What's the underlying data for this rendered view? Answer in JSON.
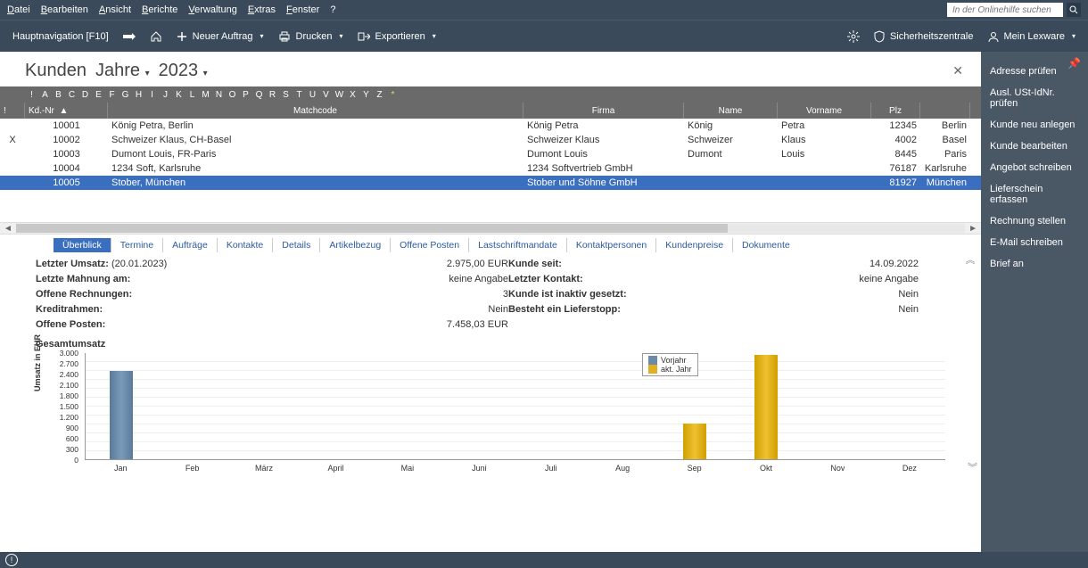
{
  "menu": {
    "items": [
      "Datei",
      "Bearbeiten",
      "Ansicht",
      "Berichte",
      "Verwaltung",
      "Extras",
      "Fenster",
      "?"
    ]
  },
  "search": {
    "placeholder": "In der Onlinehilfe suchen"
  },
  "toolbar": {
    "nav_label": "Hauptnavigation [F10]",
    "neuer_auftrag": "Neuer Auftrag",
    "drucken": "Drucken",
    "exportieren": "Exportieren",
    "sicherheit": "Sicherheitszentrale",
    "mein_lexware": "Mein Lexware"
  },
  "header": {
    "kunden": "Kunden",
    "jahre": "Jahre",
    "year": "2023"
  },
  "filter_letters": [
    "!",
    "A",
    "B",
    "C",
    "D",
    "E",
    "F",
    "G",
    "H",
    "I",
    "J",
    "K",
    "L",
    "M",
    "N",
    "O",
    "P",
    "Q",
    "R",
    "S",
    "T",
    "U",
    "V",
    "W",
    "X",
    "Y",
    "Z",
    "*"
  ],
  "columns": {
    "mark": "!",
    "kdnr": "Kd.-Nr",
    "matchcode": "Matchcode",
    "firma": "Firma",
    "name": "Name",
    "vorname": "Vorname",
    "plz": "Plz",
    "ort": ""
  },
  "rows": [
    {
      "mark": "",
      "kdnr": "10001",
      "match": "König Petra, Berlin",
      "firma": "König Petra",
      "name": "König",
      "vor": "Petra",
      "plz": "12345",
      "ort": "Berlin",
      "sel": false
    },
    {
      "mark": "X",
      "kdnr": "10002",
      "match": "Schweizer Klaus, CH-Basel",
      "firma": "Schweizer Klaus",
      "name": "Schweizer",
      "vor": "Klaus",
      "plz": "4002",
      "ort": "Basel",
      "sel": false
    },
    {
      "mark": "",
      "kdnr": "10003",
      "match": "Dumont Louis, FR-Paris",
      "firma": "Dumont Louis",
      "name": "Dumont",
      "vor": "Louis",
      "plz": "8445",
      "ort": "Paris",
      "sel": false
    },
    {
      "mark": "",
      "kdnr": "10004",
      "match": "1234 Soft, Karlsruhe",
      "firma": "1234 Softvertrieb GmbH",
      "name": "",
      "vor": "",
      "plz": "76187",
      "ort": "Karlsruhe",
      "sel": false
    },
    {
      "mark": "",
      "kdnr": "10005",
      "match": "Stober, München",
      "firma": "Stober und Söhne GmbH",
      "name": "",
      "vor": "",
      "plz": "81927",
      "ort": "München",
      "sel": true
    }
  ],
  "tabs": [
    "Überblick",
    "Termine",
    "Aufträge",
    "Kontakte",
    "Details",
    "Artikelbezug",
    "Offene Posten",
    "Lastschriftmandate",
    "Kontaktpersonen",
    "Kundenpreise",
    "Dokumente"
  ],
  "overview": {
    "letzter_umsatz_lbl": "Letzter Umsatz:",
    "letzter_umsatz_date": "(20.01.2023)",
    "letzter_umsatz_val": "2.975,00 EUR",
    "letzte_mahnung_lbl": "Letzte Mahnung am:",
    "letzte_mahnung_val": "keine Angabe",
    "offene_rech_lbl": "Offene Rechnungen:",
    "offene_rech_val": "3",
    "kreditrahmen_lbl": "Kreditrahmen:",
    "kreditrahmen_val": "Nein",
    "offene_posten_lbl": "Offene Posten:",
    "offene_posten_val": "7.458,03 EUR",
    "kunde_seit_lbl": "Kunde seit:",
    "kunde_seit_val": "14.09.2022",
    "letzter_kontakt_lbl": "Letzter Kontakt:",
    "letzter_kontakt_val": "keine Angabe",
    "inaktiv_lbl": "Kunde ist inaktiv gesetzt:",
    "inaktiv_val": "Nein",
    "lieferstopp_lbl": "Besteht ein Lieferstopp:",
    "lieferstopp_val": "Nein"
  },
  "chart_data": {
    "type": "bar",
    "title": "Gesamtumsatz",
    "ylabel": "Umsatz in EUR",
    "ylim": [
      0,
      3000
    ],
    "yticks": [
      0,
      300,
      600,
      900,
      1200,
      1500,
      1800,
      2100,
      2400,
      2700,
      3000
    ],
    "categories": [
      "Jan",
      "Feb",
      "März",
      "April",
      "Mai",
      "Juni",
      "Juli",
      "Aug",
      "Sep",
      "Okt",
      "Nov",
      "Dez"
    ],
    "series": [
      {
        "name": "Vorjahr",
        "values": [
          2500,
          0,
          0,
          0,
          0,
          0,
          0,
          0,
          0,
          0,
          0,
          0
        ]
      },
      {
        "name": "akt. Jahr",
        "values": [
          0,
          0,
          0,
          0,
          0,
          0,
          0,
          0,
          1000,
          2950,
          0,
          0
        ]
      }
    ],
    "legend": [
      "Vorjahr",
      "akt. Jahr"
    ]
  },
  "sidebar_actions": [
    "Adresse prüfen",
    "Ausl. USt-IdNr. prüfen",
    "Kunde neu anlegen",
    "Kunde bearbeiten",
    "Angebot schreiben",
    "Lieferschein erfassen",
    "Rechnung stellen",
    "E-Mail schreiben",
    "Brief an"
  ]
}
